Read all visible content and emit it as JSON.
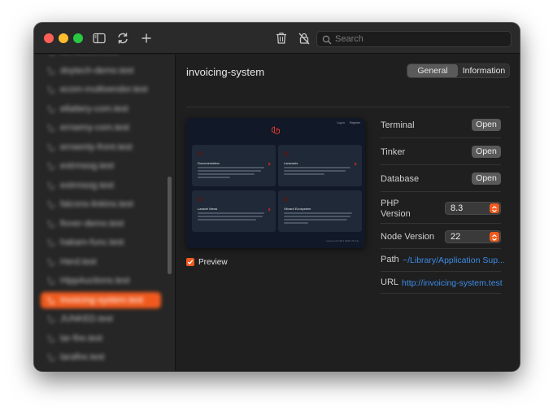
{
  "toolbar": {
    "search_placeholder": "Search",
    "icons": [
      "sidebar-toggle-icon",
      "refresh-icon",
      "plus-icon",
      "trash-icon",
      "unsecure-lock-icon",
      "search-icon"
    ]
  },
  "sidebar": {
    "items": [
      {
        "label": "domaction.test",
        "active": false
      },
      {
        "label": "doytech-demo.test",
        "active": false
      },
      {
        "label": "ecom-multivendor.test",
        "active": false
      },
      {
        "label": "ellattery-com.test",
        "active": false
      },
      {
        "label": "errsemy-com.test",
        "active": false
      },
      {
        "label": "errsemly-front.test",
        "active": false
      },
      {
        "label": "extrmsog.test",
        "active": false
      },
      {
        "label": "extrmsog.test",
        "active": false
      },
      {
        "label": "falcons-linkins.test",
        "active": false
      },
      {
        "label": "fivver-demo.test",
        "active": false
      },
      {
        "label": "hakam-func.test",
        "active": false
      },
      {
        "label": "Herd.test",
        "active": false
      },
      {
        "label": "HippAuctions.test",
        "active": false
      },
      {
        "label": "invoicing-system.test",
        "active": true
      },
      {
        "label": "JUNKED.test",
        "active": false
      },
      {
        "label": "lar-fire.test",
        "active": false
      },
      {
        "label": "larafire.test",
        "active": false
      }
    ]
  },
  "main": {
    "title": "invoicing-system",
    "tabs": [
      {
        "label": "General",
        "selected": true
      },
      {
        "label": "Information",
        "selected": false
      }
    ],
    "preview": {
      "checkbox_label": "Preview",
      "checked": true,
      "nav_links": [
        "Log in",
        "Register"
      ],
      "tiles": [
        {
          "title": "Documentation"
        },
        {
          "title": "Laracasts"
        },
        {
          "title": "Laravel News"
        },
        {
          "title": "Vibrant Ecosystem"
        }
      ],
      "footer": "Laravel v10.48.4 (PHP v8.3.4)"
    },
    "details": {
      "terminal_label": "Terminal",
      "terminal_button": "Open",
      "tinker_label": "Tinker",
      "tinker_button": "Open",
      "database_label": "Database",
      "database_button": "Open",
      "php_label": "PHP\nVersion",
      "php_value": "8.3",
      "node_label": "Node Version",
      "node_value": "22",
      "path_label": "Path",
      "path_value": "~/Library/Application Sup...",
      "url_label": "URL",
      "url_value": "http://invoicing-system.test"
    }
  },
  "colors": {
    "accent": "#f05a1e",
    "link": "#3c8ce7",
    "window_bg": "#1e1e1e",
    "sidebar_bg": "#262626"
  }
}
